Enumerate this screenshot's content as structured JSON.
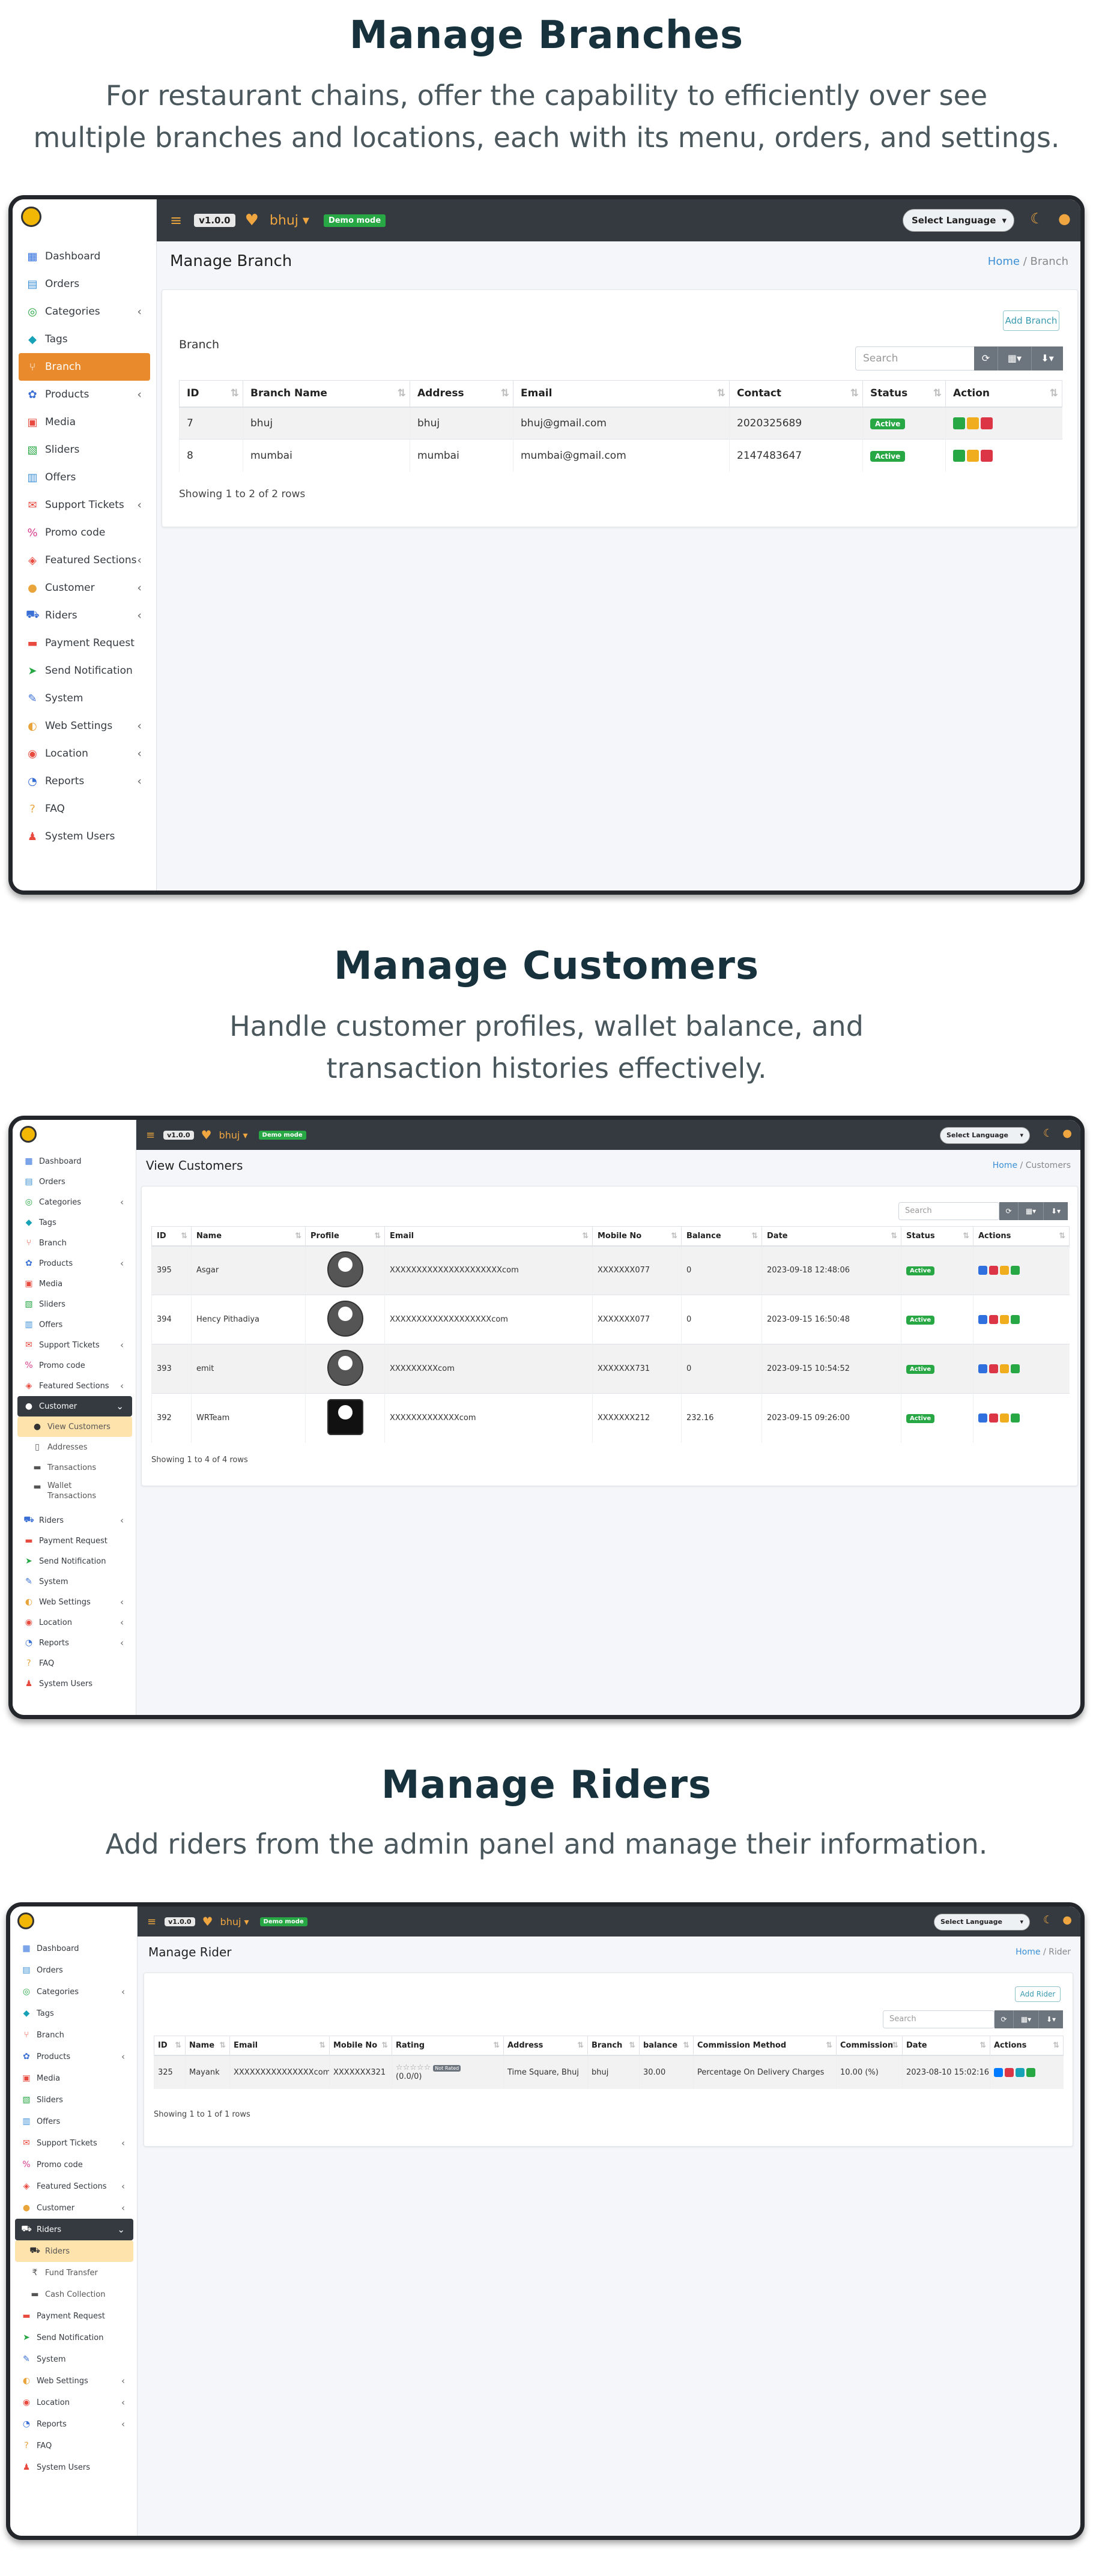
{
  "sections": [
    {
      "title": "Manage Branches",
      "desc1": "For restaurant chains, offer the capability to efficiently over see",
      "desc2": "multiple branches and locations, each with its menu, orders, and settings."
    },
    {
      "title": "Manage Customers",
      "desc1": "Handle customer profiles, wallet balance, and",
      "desc2": "transaction histories effectively."
    },
    {
      "title": "Manage Riders",
      "desc1": "Add riders from the admin panel and manage their information."
    }
  ],
  "topbar": {
    "menu_icon": "hamburger-icon",
    "version": "v1.0.0",
    "branch": "bhuj",
    "demo": "Demo mode",
    "language": "Select Language"
  },
  "nav1": [
    {
      "icon": "dashboard-icon",
      "label": "Dashboard",
      "color": "#2f6fde"
    },
    {
      "icon": "orders-icon",
      "label": "Orders",
      "color": "#3a8fd6"
    },
    {
      "icon": "categories-icon",
      "label": "Categories",
      "color": "#28a745",
      "caret": true
    },
    {
      "icon": "tags-icon",
      "label": "Tags",
      "color": "#17a2b8"
    },
    {
      "icon": "branch-icon",
      "label": "Branch",
      "color": "#e9533e",
      "active": true
    },
    {
      "icon": "products-icon",
      "label": "Products",
      "color": "#3a6fd6",
      "caret": true
    },
    {
      "icon": "media-icon",
      "label": "Media",
      "color": "#e84a3f"
    },
    {
      "icon": "sliders-icon",
      "label": "Sliders",
      "color": "#28a745"
    },
    {
      "icon": "offers-icon",
      "label": "Offers",
      "color": "#3a8fd6"
    },
    {
      "icon": "support-tickets-icon",
      "label": "Support Tickets",
      "color": "#e84a3f",
      "caret": true
    },
    {
      "icon": "promo-code-icon",
      "label": "Promo code",
      "color": "#d63a8a"
    },
    {
      "icon": "featured-sections-icon",
      "label": "Featured Sections",
      "color": "#e84a3f",
      "caret": true
    },
    {
      "icon": "customer-icon",
      "label": "Customer",
      "color": "#e9a43b",
      "caret": true
    },
    {
      "icon": "riders-icon",
      "label": "Riders",
      "color": "#3a6fd6",
      "caret": true
    },
    {
      "icon": "payment-request-icon",
      "label": "Payment Request",
      "color": "#e84a3f"
    },
    {
      "icon": "send-notification-icon",
      "label": "Send Notification",
      "color": "#28a745"
    },
    {
      "icon": "system-icon",
      "label": "System",
      "color": "#3a6fd6"
    },
    {
      "icon": "web-settings-icon",
      "label": "Web Settings",
      "color": "#e9a43b",
      "caret": true
    },
    {
      "icon": "location-icon",
      "label": "Location",
      "color": "#e84a3f",
      "caret": true
    },
    {
      "icon": "reports-icon",
      "label": "Reports",
      "color": "#3a6fd6",
      "caret": true
    },
    {
      "icon": "faq-icon",
      "label": "FAQ",
      "color": "#e9a43b"
    },
    {
      "icon": "system-users-icon",
      "label": "System Users",
      "color": "#e84a3f"
    }
  ],
  "branch_page": {
    "title": "Manage Branch",
    "crumb_home": "Home",
    "crumb_sep": "/",
    "crumb_cur": "Branch",
    "add_btn": "Add Branch",
    "card_title": "Branch",
    "search": "Search",
    "columns": [
      "ID",
      "Branch Name",
      "Address",
      "Email",
      "Contact",
      "Status",
      "Action"
    ],
    "rows": [
      [
        "7",
        "bhuj",
        "bhuj",
        "bhuj@gmail.com",
        "2020325689",
        "Active"
      ],
      [
        "8",
        "mumbai",
        "mumbai",
        "mumbai@gmail.com",
        "2147483647",
        "Active"
      ]
    ],
    "showing": "Showing 1 to 2 of 2 rows"
  },
  "nav2": [
    {
      "icon": "dashboard-icon",
      "label": "Dashboard",
      "color": "#2f6fde"
    },
    {
      "icon": "orders-icon",
      "label": "Orders",
      "color": "#3a8fd6"
    },
    {
      "icon": "categories-icon",
      "label": "Categories",
      "color": "#28a745",
      "caret": true
    },
    {
      "icon": "tags-icon",
      "label": "Tags",
      "color": "#17a2b8"
    },
    {
      "icon": "branch-icon",
      "label": "Branch",
      "color": "#e9533e"
    },
    {
      "icon": "products-icon",
      "label": "Products",
      "color": "#3a6fd6",
      "caret": true
    },
    {
      "icon": "media-icon",
      "label": "Media",
      "color": "#e84a3f"
    },
    {
      "icon": "sliders-icon",
      "label": "Sliders",
      "color": "#28a745"
    },
    {
      "icon": "offers-icon",
      "label": "Offers",
      "color": "#3a8fd6"
    },
    {
      "icon": "support-tickets-icon",
      "label": "Support Tickets",
      "color": "#e84a3f",
      "caret": true
    },
    {
      "icon": "promo-code-icon",
      "label": "Promo code",
      "color": "#d63a8a"
    },
    {
      "icon": "featured-sections-icon",
      "label": "Featured Sections",
      "color": "#e84a3f",
      "caret": true
    },
    {
      "icon": "customer-icon",
      "label": "Customer",
      "color": "#e9a43b",
      "open": true,
      "caret": true
    },
    {
      "icon": "view-customers-icon",
      "label": "View Customers",
      "color": "#333",
      "sub": true,
      "sel": true
    },
    {
      "icon": "addresses-icon",
      "label": "Addresses",
      "color": "#555",
      "sub": true
    },
    {
      "icon": "transactions-icon",
      "label": "Transactions",
      "color": "#555",
      "sub": true
    },
    {
      "icon": "wallet-icon",
      "label": "Wallet",
      "label2": "Transactions",
      "color": "#555",
      "sub": true,
      "two": true
    },
    {
      "icon": "riders-icon",
      "label": "Riders",
      "color": "#3a6fd6",
      "caret": true
    },
    {
      "icon": "payment-request-icon",
      "label": "Payment Request",
      "color": "#e84a3f"
    },
    {
      "icon": "send-notification-icon",
      "label": "Send Notification",
      "color": "#28a745"
    },
    {
      "icon": "system-icon",
      "label": "System",
      "color": "#3a6fd6"
    },
    {
      "icon": "web-settings-icon",
      "label": "Web Settings",
      "color": "#e9a43b",
      "caret": true
    },
    {
      "icon": "location-icon",
      "label": "Location",
      "color": "#e84a3f",
      "caret": true
    },
    {
      "icon": "reports-icon",
      "label": "Reports",
      "color": "#3a6fd6",
      "caret": true
    },
    {
      "icon": "faq-icon",
      "label": "FAQ",
      "color": "#e9a43b"
    },
    {
      "icon": "system-users-icon",
      "label": "System Users",
      "color": "#e84a3f"
    }
  ],
  "customers_page": {
    "title": "View Customers",
    "crumb_home": "Home",
    "crumb_sep": "/",
    "crumb_cur": "Customers",
    "search": "Search",
    "columns": [
      "ID",
      "Name",
      "Profile",
      "Email",
      "Mobile No",
      "Balance",
      "Date",
      "Status",
      "Actions"
    ],
    "rows": [
      [
        "395",
        "Asgar",
        "XXXXXXXXXXXXXXXXXXXXXcom",
        "XXXXXXX077",
        "0",
        "2023-09-18 12:48:06",
        "Active"
      ],
      [
        "394",
        "Hency Pithadiya",
        "XXXXXXXXXXXXXXXXXXXcom",
        "XXXXXXX077",
        "0",
        "2023-09-15 16:50:48",
        "Active"
      ],
      [
        "393",
        "emit",
        "XXXXXXXXXcom",
        "XXXXXXX731",
        "0",
        "2023-09-15 10:54:52",
        "Active"
      ],
      [
        "392",
        "WRTeam",
        "XXXXXXXXXXXXXcom",
        "XXXXXXX212",
        "232.16",
        "2023-09-15 09:26:00",
        "Active"
      ]
    ],
    "showing": "Showing 1 to 4 of 4 rows"
  },
  "nav3": [
    {
      "icon": "dashboard-icon",
      "label": "Dashboard",
      "color": "#2f6fde"
    },
    {
      "icon": "orders-icon",
      "label": "Orders",
      "color": "#3a8fd6"
    },
    {
      "icon": "categories-icon",
      "label": "Categories",
      "color": "#28a745",
      "caret": true
    },
    {
      "icon": "tags-icon",
      "label": "Tags",
      "color": "#17a2b8"
    },
    {
      "icon": "branch-icon",
      "label": "Branch",
      "color": "#e9533e"
    },
    {
      "icon": "products-icon",
      "label": "Products",
      "color": "#3a6fd6",
      "caret": true
    },
    {
      "icon": "media-icon",
      "label": "Media",
      "color": "#e84a3f"
    },
    {
      "icon": "sliders-icon",
      "label": "Sliders",
      "color": "#28a745"
    },
    {
      "icon": "offers-icon",
      "label": "Offers",
      "color": "#3a8fd6"
    },
    {
      "icon": "support-tickets-icon",
      "label": "Support Tickets",
      "color": "#e84a3f",
      "caret": true
    },
    {
      "icon": "promo-code-icon",
      "label": "Promo code",
      "color": "#d63a8a"
    },
    {
      "icon": "featured-sections-icon",
      "label": "Featured Sections",
      "color": "#e84a3f",
      "caret": true
    },
    {
      "icon": "customer-icon",
      "label": "Customer",
      "color": "#e9a43b",
      "caret": true
    },
    {
      "icon": "riders-icon",
      "label": "Riders",
      "color": "#3a6fd6",
      "open": true,
      "caret": true
    },
    {
      "icon": "riders-list-icon",
      "label": "Riders",
      "color": "#333",
      "sub": true,
      "sel": true
    },
    {
      "icon": "fund-transfer-icon",
      "label": "Fund Transfer",
      "color": "#555",
      "sub": true
    },
    {
      "icon": "cash-collection-icon",
      "label": "Cash Collection",
      "color": "#555",
      "sub": true
    },
    {
      "icon": "payment-request-icon",
      "label": "Payment Request",
      "color": "#e84a3f"
    },
    {
      "icon": "send-notification-icon",
      "label": "Send Notification",
      "color": "#28a745"
    },
    {
      "icon": "system-icon",
      "label": "System",
      "color": "#3a6fd6"
    },
    {
      "icon": "web-settings-icon",
      "label": "Web Settings",
      "color": "#e9a43b",
      "caret": true
    },
    {
      "icon": "location-icon",
      "label": "Location",
      "color": "#e84a3f",
      "caret": true
    },
    {
      "icon": "reports-icon",
      "label": "Reports",
      "color": "#3a6fd6",
      "caret": true
    },
    {
      "icon": "faq-icon",
      "label": "FAQ",
      "color": "#e9a43b"
    },
    {
      "icon": "system-users-icon",
      "label": "System Users",
      "color": "#e84a3f"
    }
  ],
  "riders_page": {
    "title": "Manage Rider",
    "crumb_home": "Home",
    "crumb_sep": "/",
    "crumb_cur": "Rider",
    "add_btn": "Add Rider",
    "search": "Search",
    "columns": [
      "ID",
      "Name",
      "Email",
      "Mobile No",
      "Rating",
      "Address",
      "Branch",
      "balance",
      "Commission Method",
      "Commission",
      "Date",
      "Actions"
    ],
    "rows": [
      {
        "id": "325",
        "name": "Mayank",
        "email": "XXXXXXXXXXXXXXXcom",
        "mobile": "XXXXXXX321",
        "stars": "☆☆☆☆☆",
        "rating_badge": "Not Rated",
        "rating_count": "(0.0/0)",
        "address": "Time Square, Bhuj",
        "branch": "bhuj",
        "balance": "30.00",
        "method": "Percentage On Delivery Charges",
        "commission": "10.00 (%)",
        "date": "2023-08-10 15:02:16"
      }
    ],
    "showing": "Showing 1 to 1 of 1 rows"
  }
}
